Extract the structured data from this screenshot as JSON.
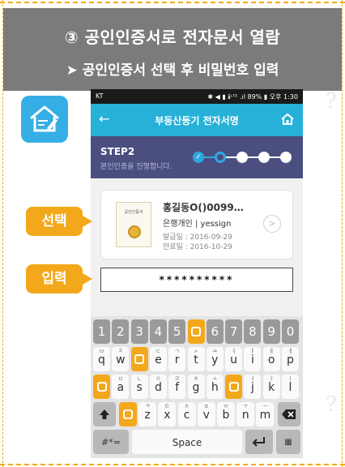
{
  "banner": {
    "title": "③ 공인인증서로 전자문서 열람",
    "subtitle": "➤ 공인인증서 선택 후 비밀번호 입력"
  },
  "status_bar": {
    "carrier": "KT",
    "right": "✱ ◀ ▮ ℹᴸᵀᴱ .ıl 89% ▮ 오후 1:30"
  },
  "app_bar": {
    "back_icon": "←",
    "title": "부동산등기 전자서명",
    "home_icon": "home-icon"
  },
  "step": {
    "label": "STEP2",
    "description": "본인인증을 진행합니다.",
    "progress": {
      "current": 2,
      "total": 5
    }
  },
  "certificate": {
    "thumb_label": "공인인증서",
    "name": "홍길동O()0099…",
    "issuer": "은행개인 | yessign",
    "issued": "발급일 : 2016-09-29",
    "expires": "만료일 : 2016-10-29"
  },
  "password": {
    "masked_value": "**********"
  },
  "callouts": {
    "select": "선택",
    "input": "입력"
  },
  "keyboard": {
    "row0": [
      "1",
      "2",
      "3",
      "4",
      "5",
      "",
      "6",
      "7",
      "8",
      "9",
      "0"
    ],
    "row1": [
      {
        "k": "q",
        "s": "ㅂ"
      },
      {
        "k": "w",
        "s": "ㅈ"
      },
      {
        "k": "",
        "s": ""
      },
      {
        "k": "e",
        "s": "ㄷ"
      },
      {
        "k": "r",
        "s": "ㄱ"
      },
      {
        "k": "t",
        "s": "ㅅ"
      },
      {
        "k": "y",
        "s": "ㅛ"
      },
      {
        "k": "u",
        "s": "ㅕ"
      },
      {
        "k": "i",
        "s": "ㅑ"
      },
      {
        "k": "o",
        "s": "ㅐ"
      },
      {
        "k": "p",
        "s": "ㅔ"
      }
    ],
    "row2": [
      {
        "k": "",
        "s": ""
      },
      {
        "k": "a",
        "s": "ㅁ"
      },
      {
        "k": "s",
        "s": "ㄴ"
      },
      {
        "k": "d",
        "s": "ㅇ"
      },
      {
        "k": "f",
        "s": "ㄹ"
      },
      {
        "k": "g",
        "s": "ㅎ"
      },
      {
        "k": "h",
        "s": "ㅗ"
      },
      {
        "k": "",
        "s": ""
      },
      {
        "k": "j",
        "s": "ㅓ"
      },
      {
        "k": "k",
        "s": "ㅏ"
      },
      {
        "k": "l",
        "s": "ㅣ"
      }
    ],
    "row3": [
      {
        "k": "",
        "s": ""
      },
      {
        "k": "z",
        "s": "ㅋ"
      },
      {
        "k": "x",
        "s": "ㅌ"
      },
      {
        "k": "c",
        "s": "ㅊ"
      },
      {
        "k": "v",
        "s": "ㅍ"
      },
      {
        "k": "b",
        "s": "ㅠ"
      },
      {
        "k": "n",
        "s": "ㅜ"
      },
      {
        "k": "m",
        "s": "ㅡ"
      }
    ],
    "shift_icon": "shift-icon",
    "backspace_icon": "backspace-icon",
    "symbols_label": "#*=",
    "space_label": "Space",
    "enter_icon": "enter-icon"
  },
  "colors": {
    "accent_orange": "#f3a81b",
    "app_blue": "#27b1d8",
    "step_navy": "#4a4f7f",
    "banner_gray": "#7b7b7b"
  }
}
